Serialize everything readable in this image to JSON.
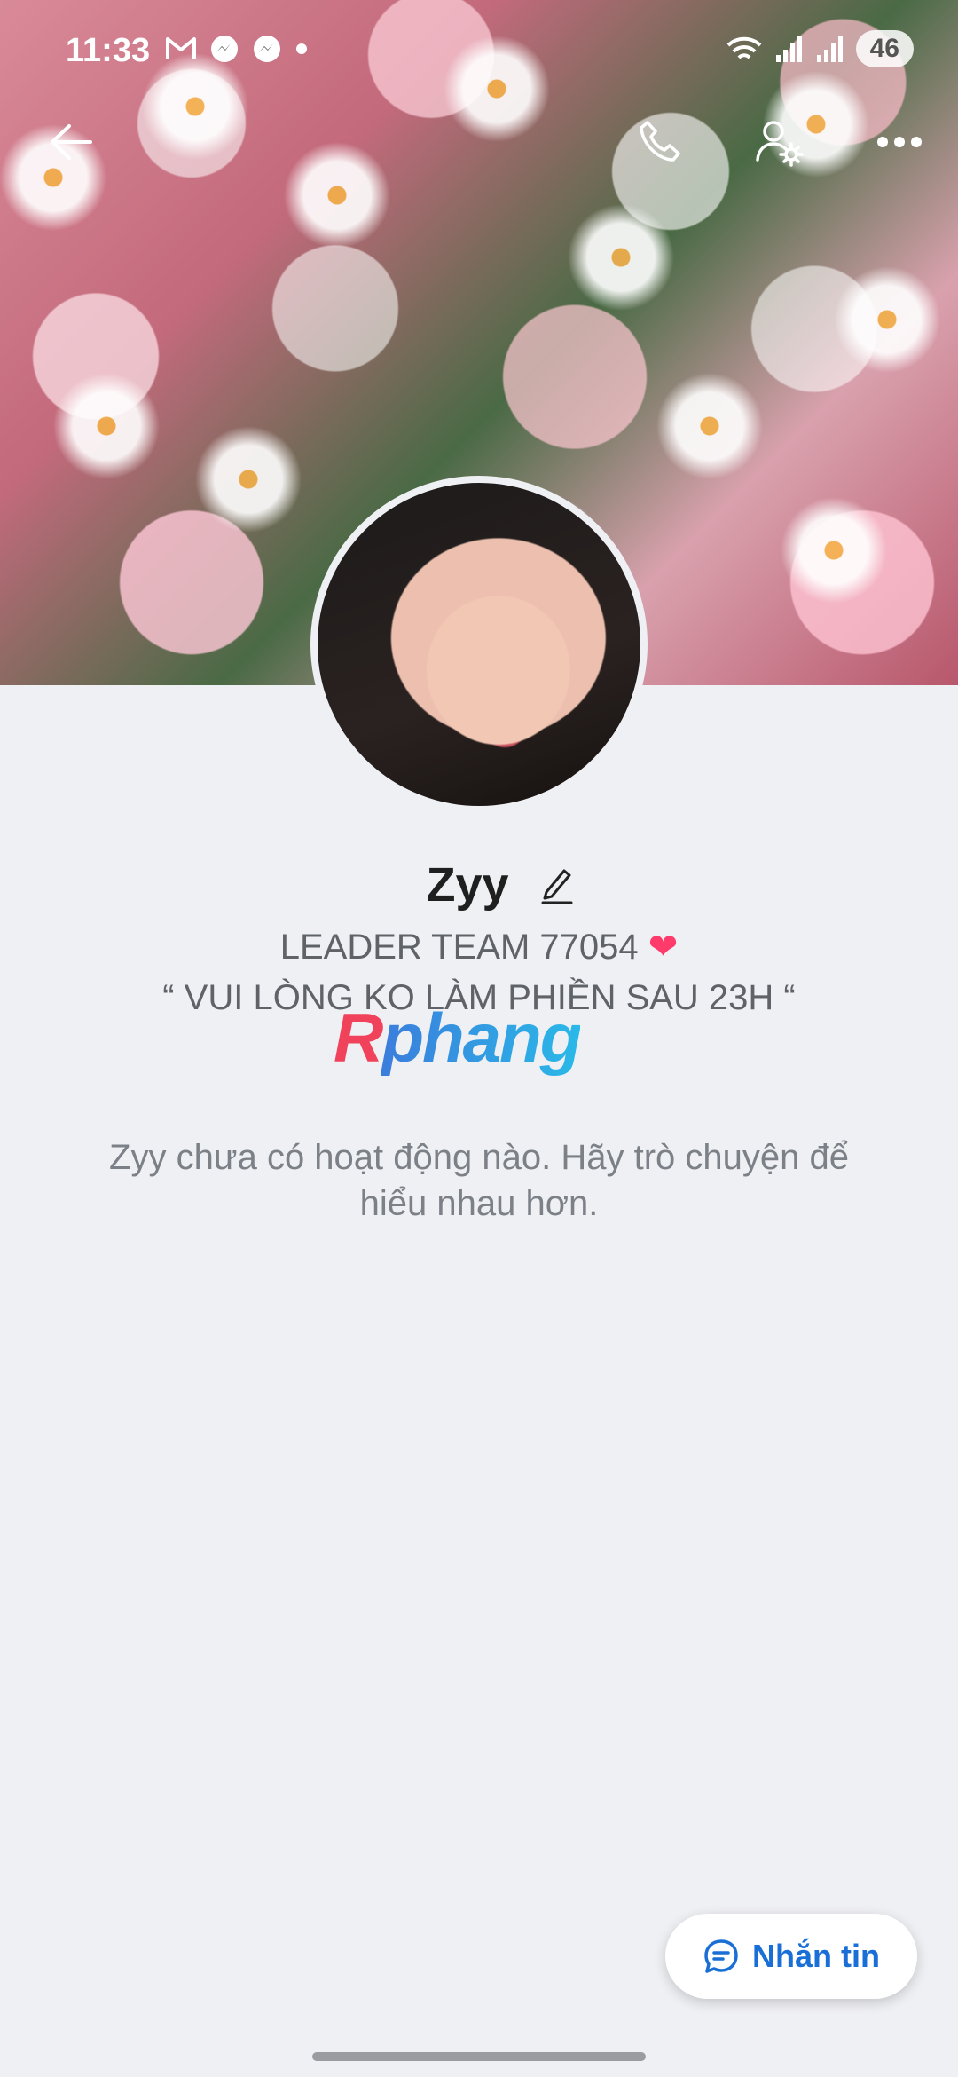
{
  "status_bar": {
    "time": "11:33",
    "battery": "46",
    "notification_icons": [
      "gmail-icon",
      "messenger-icon",
      "messenger-icon",
      "dot"
    ]
  },
  "top_actions": {
    "back_icon": "arrow-left-icon",
    "call_icon": "phone-icon",
    "settings_icon": "user-settings-icon",
    "more_icon": "more-horizontal-icon"
  },
  "profile": {
    "name": "Zyy",
    "bio_line_1": "LEADER TEAM 77054",
    "bio_heart": "❤",
    "bio_line_2": "“ VUI LÒNG KO LÀM PHIỀN SAU 23H “",
    "empty_activity": "Zyy chưa có hoạt động nào. Hãy trò chuyện để hiểu nhau hơn."
  },
  "watermark": {
    "first": "R",
    "rest": "phang"
  },
  "message_button": {
    "label": "Nhắn tin",
    "icon": "chat-bubble-icon"
  },
  "colors": {
    "accent": "#1a6fd6",
    "background": "#eff0f4"
  }
}
